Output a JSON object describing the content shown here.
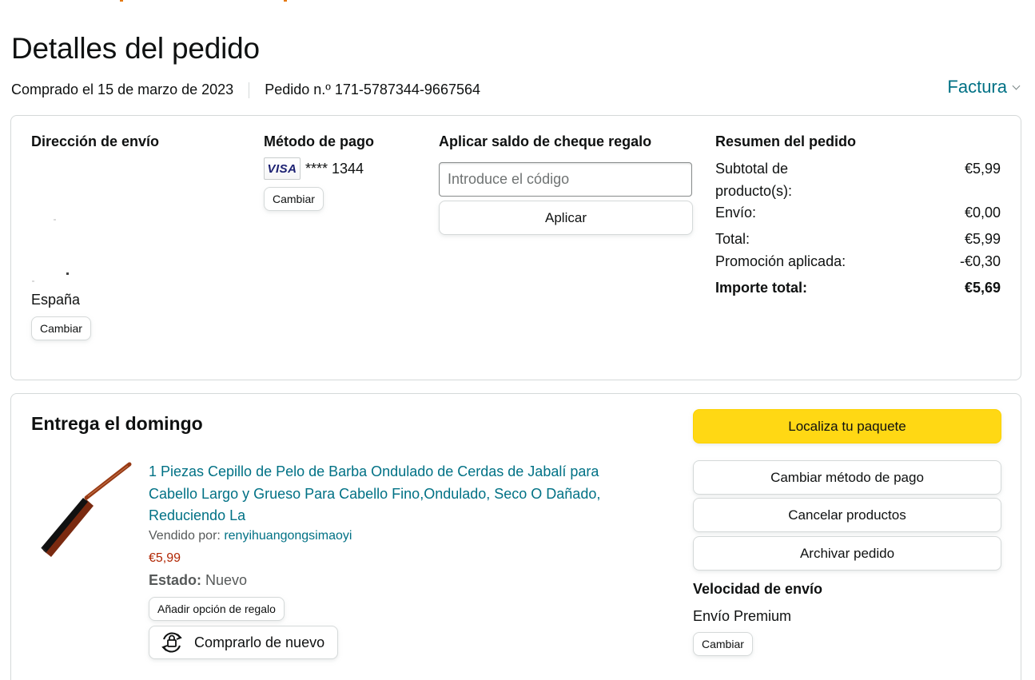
{
  "header": {
    "title": "Detalles del pedido",
    "purchased": "Comprado el 15 de marzo de 2023",
    "order_number": "Pedido n.º 171-5787344-9667564",
    "invoice_label": "Factura"
  },
  "shipping_address": {
    "title": "Dirección de envío",
    "country": "España",
    "change_label": "Cambiar"
  },
  "payment": {
    "title": "Método de pago",
    "card_brand": "VISA",
    "card_number": "**** 1344",
    "change_label": "Cambiar"
  },
  "gift_card": {
    "title": "Aplicar saldo de cheque regalo",
    "placeholder": "Introduce el código",
    "apply_label": "Aplicar"
  },
  "summary": {
    "title": "Resumen del pedido",
    "rows": [
      {
        "label": "Subtotal de producto(s):",
        "value": "€5,99"
      },
      {
        "label": "Envío:",
        "value": "€0,00"
      },
      {
        "label": "Total:",
        "value": "€5,99"
      },
      {
        "label": "Promoción aplicada:",
        "value": "-€0,30"
      }
    ],
    "grand_total": {
      "label": "Importe total:",
      "value": "€5,69"
    }
  },
  "delivery": {
    "title": "Entrega el domingo",
    "product": {
      "title": "1 Piezas Cepillo de Pelo de Barba Ondulado de Cerdas de Jabalí para Cabello Largo y Grueso Para Cabello Fino,Ondulado, Seco O Dañado, Reduciendo La",
      "sold_by_label": "Vendido por:",
      "seller": "renyihuangongsimaoyi",
      "price": "€5,99",
      "state_label": "Estado:",
      "state_value": "Nuevo",
      "gift_option_label": "Añadir opción de regalo",
      "buy_again_label": "Comprarlo de nuevo"
    },
    "actions": {
      "track": "Localiza tu paquete",
      "change_payment": "Cambiar método de pago",
      "cancel": "Cancelar productos",
      "archive": "Archivar pedido"
    },
    "shipping_speed": {
      "title": "Velocidad de envío",
      "value": "Envío Premium",
      "change_label": "Cambiar"
    }
  },
  "colors": {
    "link": "#007185",
    "price": "#b12704",
    "primary_button": "#ffd814",
    "border": "#d5d9d9"
  },
  "icons": [
    "chevron-down-icon",
    "visa-card-icon",
    "buy-again-icon"
  ]
}
